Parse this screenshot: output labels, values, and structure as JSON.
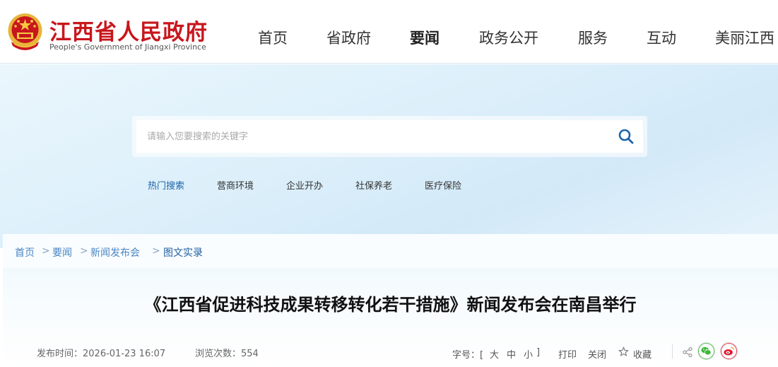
{
  "header": {
    "logo_cn": "江西省人民政府",
    "logo_en": "People's Government of Jiangxi Province",
    "nav": [
      {
        "label": "首页",
        "active": false
      },
      {
        "label": "省政府",
        "active": false
      },
      {
        "label": "要闻",
        "active": true
      },
      {
        "label": "政务公开",
        "active": false
      },
      {
        "label": "服务",
        "active": false
      },
      {
        "label": "互动",
        "active": false
      },
      {
        "label": "美丽江西",
        "active": false
      }
    ]
  },
  "search": {
    "placeholder": "请输入您要搜索的关键字",
    "button_icon": "search-icon",
    "hot_label": "热门搜索",
    "hot_terms": [
      "营商环境",
      "企业开办",
      "社保养老",
      "医疗保险"
    ]
  },
  "breadcrumb": {
    "items": [
      "首页",
      "要闻",
      "新闻发布会",
      "图文实录"
    ],
    "separator": ">"
  },
  "article": {
    "title": "《江西省促进科技成果转移转化若干措施》新闻发布会在南昌举行",
    "publish_time": "发布时间：2026-01-23 16:07",
    "views": "浏览次数：554",
    "font_size_label": "字号：[",
    "font_large": "大",
    "font_medium": "中",
    "font_small": "小",
    "font_size_end": "]",
    "print": "打印",
    "close": "关闭",
    "favorite": "收藏"
  },
  "colors": {
    "brand_red": "#c8161d",
    "link_blue": "#4a86c4",
    "wechat_green": "#3fb838",
    "weibo_red": "#e6162d"
  }
}
